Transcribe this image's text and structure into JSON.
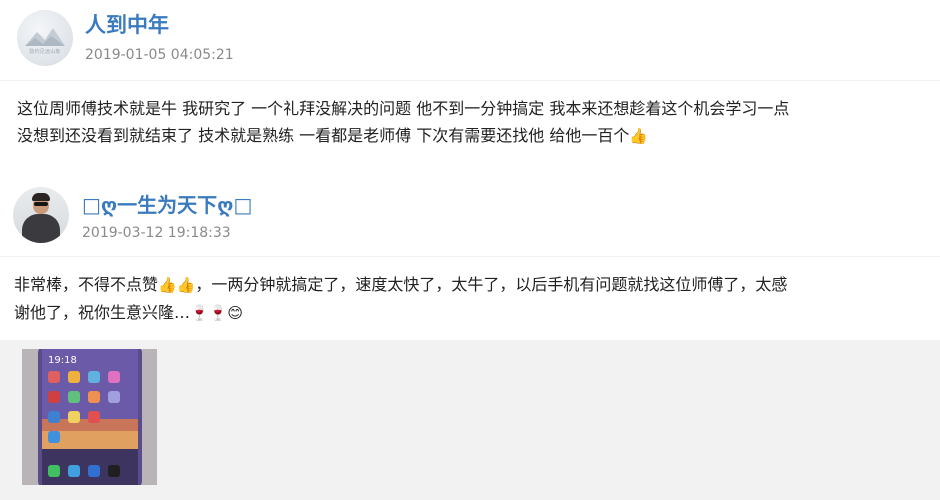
{
  "reviews": [
    {
      "username": "人到中年",
      "timestamp": "2019-01-05 04:05:21",
      "avatar_icon": "landscape-avatar-icon",
      "avatar_watermark": "隐约见远山象",
      "text_line1": "这位周师傅技术就是牛 我研究了 一个礼拜没解决的问题 他不到一分钟搞定 我本来还想趁着这个机会学习一点",
      "text_line2": "没想到还没看到就结束了 技术就是熟练 一看都是老师傅 下次有需要还找他 给他一百个"
    },
    {
      "username": "□ღ一生为天下ღ□",
      "timestamp": "2019-03-12 19:18:33",
      "avatar_icon": "man-with-sunglasses-avatar-icon",
      "text_line1": "非常棒，不得不点赞",
      "text_line1b": "，一两分钟就搞定了，速度太快了，太牛了，以后手机有问题就找这位师傅了，太感",
      "text_line2": "谢他了，祝你生意兴隆…",
      "photo_icon": "phone-photo-thumbnail"
    }
  ],
  "emoji": {
    "thumbs_up": "👍",
    "cheers": "🍷",
    "smile": "😊"
  },
  "colors": {
    "username": "#3a7bbf",
    "timestamp": "#8a8a8a",
    "body_text": "#222222",
    "photo_strip_bg": "#f2f2f2"
  }
}
